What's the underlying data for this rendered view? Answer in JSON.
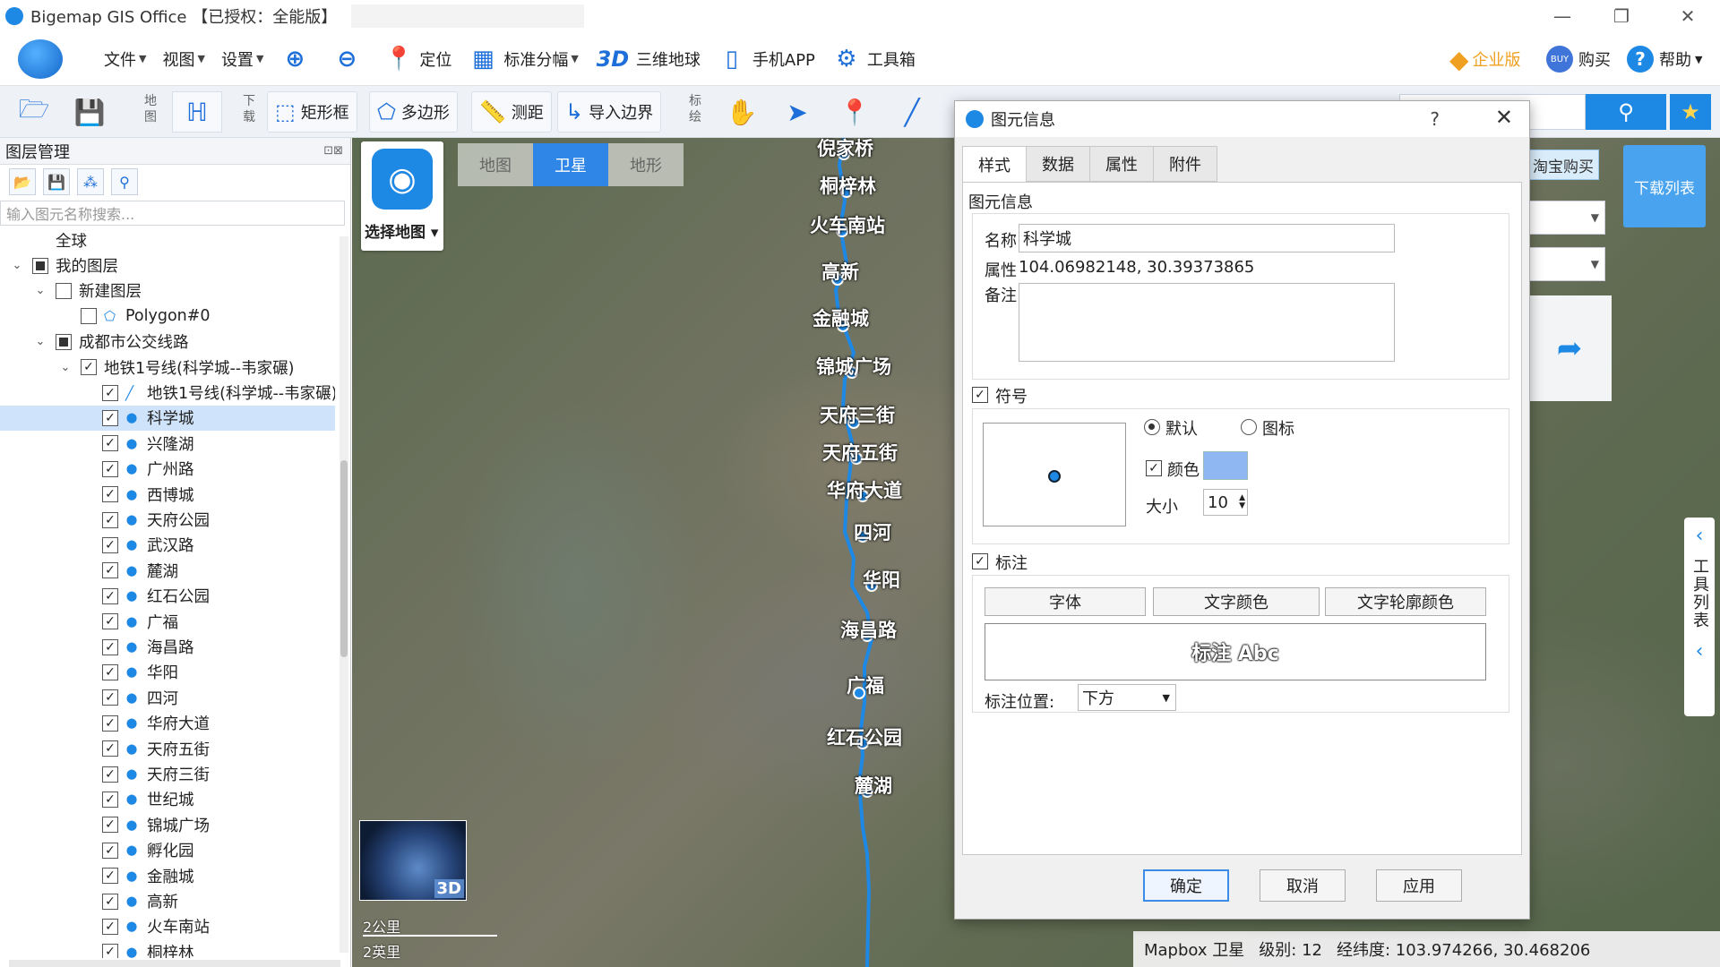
{
  "app": {
    "title": "Bigemap GIS Office  【已授权：全能版】"
  },
  "menu": {
    "file": "文件",
    "view": "视图",
    "settings": "设置",
    "locate": "定位",
    "grid": "标准分幅",
    "globe": "三维地球",
    "mobile": "手机APP",
    "toolbox": "工具箱",
    "enterprise": "企业版",
    "buy": "购买",
    "help": "帮助"
  },
  "toolbar": {
    "map_v": "地图",
    "download_v": "下载",
    "draw_v": "标绘",
    "rect": "矩形框",
    "polygon": "多边形",
    "measure": "测距",
    "import_border": "导入边界"
  },
  "left_panel": {
    "title": "图层管理",
    "search_placeholder": "输入图元名称搜索...",
    "tree": [
      {
        "label": "全球",
        "indent": 0
      },
      {
        "label": "我的图层",
        "indent": 0
      },
      {
        "label": "新建图层",
        "indent": 1
      },
      {
        "label": "Polygon#0",
        "indent": 2
      },
      {
        "label": "成都市公交线路",
        "indent": 1
      },
      {
        "label": "地铁1号线(科学城--韦家碾)",
        "indent": 2
      },
      {
        "label": "地铁1号线(科学城--韦家碾)",
        "indent": 3
      },
      {
        "label": "科学城",
        "indent": 3
      },
      {
        "label": "兴隆湖",
        "indent": 3
      },
      {
        "label": "广州路",
        "indent": 3
      },
      {
        "label": "西博城",
        "indent": 3
      },
      {
        "label": "天府公园",
        "indent": 3
      },
      {
        "label": "武汉路",
        "indent": 3
      },
      {
        "label": "麓湖",
        "indent": 3
      },
      {
        "label": "红石公园",
        "indent": 3
      },
      {
        "label": "广福",
        "indent": 3
      },
      {
        "label": "海昌路",
        "indent": 3
      },
      {
        "label": "华阳",
        "indent": 3
      },
      {
        "label": "四河",
        "indent": 3
      },
      {
        "label": "华府大道",
        "indent": 3
      },
      {
        "label": "天府五街",
        "indent": 3
      },
      {
        "label": "天府三街",
        "indent": 3
      },
      {
        "label": "世纪城",
        "indent": 3
      },
      {
        "label": "锦城广场",
        "indent": 3
      },
      {
        "label": "孵化园",
        "indent": 3
      },
      {
        "label": "金融城",
        "indent": 3
      },
      {
        "label": "高新",
        "indent": 3
      },
      {
        "label": "火车南站",
        "indent": 3
      },
      {
        "label": "桐梓林",
        "indent": 3
      }
    ]
  },
  "map": {
    "types": [
      "地图",
      "卫星",
      "地形"
    ],
    "select_map": "选择地图",
    "stations": [
      "倪家桥",
      "桐梓林",
      "火车南站",
      "高新",
      "金融城",
      "锦城广场",
      "天府三街",
      "天府五街",
      "华府大道",
      "四河",
      "华阳",
      "海昌路",
      "广福",
      "红石公园",
      "麓湖"
    ],
    "scale_km": "2公里",
    "scale_mi": "2英里",
    "globe_badge": "3D",
    "taobao": "淘宝购买",
    "download_list": "下载列表",
    "tool_list": "工具列表"
  },
  "status": {
    "source": "Mapbox 卫星",
    "level_label": "级别:",
    "level": "12",
    "coord_label": "经纬度:",
    "coord": "103.974266, 30.468206"
  },
  "dialog": {
    "title": "图元信息",
    "help": "?",
    "tabs": [
      "样式",
      "数据",
      "属性",
      "附件"
    ],
    "group_info": "图元信息",
    "name_label": "名称",
    "name_value": "科学城",
    "attr_label": "属性",
    "attr_value": "104.06982148, 30.39373865",
    "note_label": "备注",
    "symbol_label": "符号",
    "default_label": "默认",
    "icon_label": "图标",
    "color_label": "颜色",
    "size_label": "大小",
    "size_value": "10",
    "annot_label": "标注",
    "font_btn": "字体",
    "text_color_btn": "文字颜色",
    "outline_color_btn": "文字轮廓颜色",
    "preview": "标注 Abc",
    "position_label": "标注位置:",
    "position_value": "下方",
    "ok": "确定",
    "cancel": "取消",
    "apply": "应用",
    "symbol_color": "#8fb8f3"
  }
}
